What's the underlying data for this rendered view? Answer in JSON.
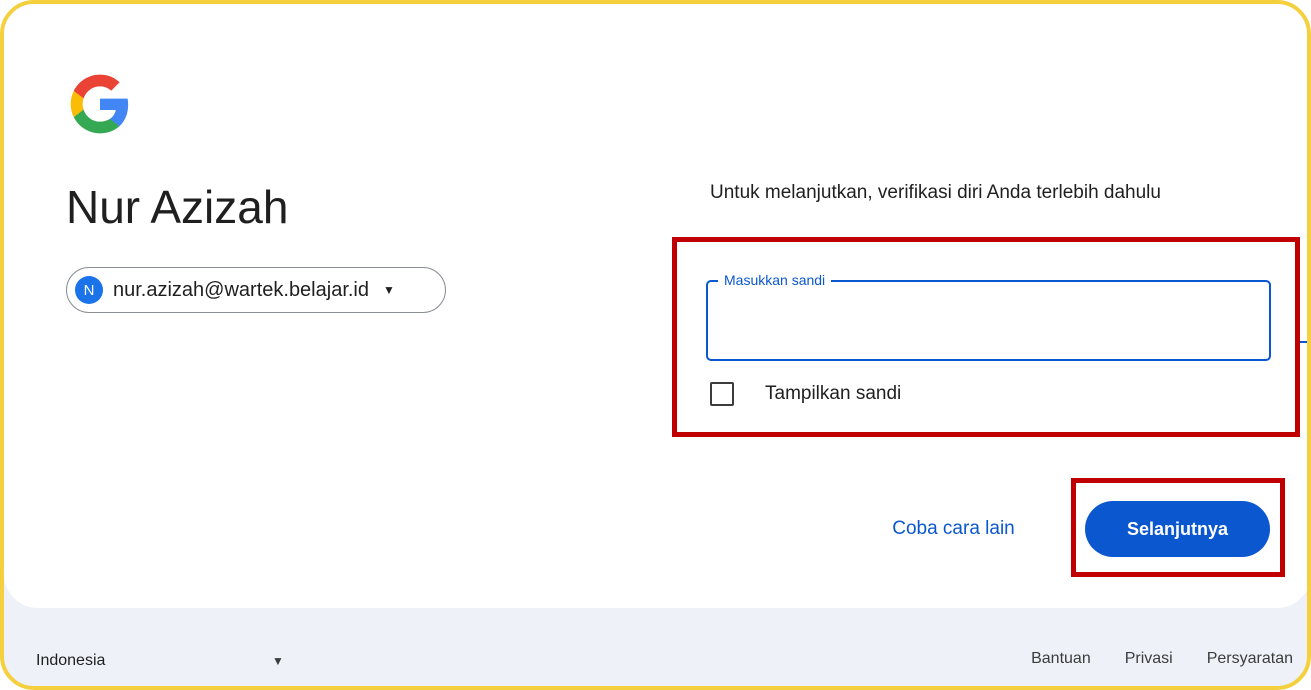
{
  "brand": {
    "logo_icon": "google-g-logo-icon"
  },
  "profile": {
    "name": "Nur Azizah",
    "email": "nur.azizah@wartek.belajar.id",
    "avatar_letter": "N",
    "chip_caret_icon": "caret-down-icon"
  },
  "verify": {
    "instruction": "Untuk melanjutkan, verifikasi diri Anda terlebih dahulu",
    "password_label": "Masukkan sandi",
    "password_value": "",
    "show_password_label": "Tampilkan sandi",
    "show_password_checked": false
  },
  "actions": {
    "try_other_label": "Coba cara lain",
    "next_label": "Selanjutnya"
  },
  "footer": {
    "language": "Indonesia",
    "links": [
      "Bantuan",
      "Privasi",
      "Persyaratan"
    ]
  },
  "colors": {
    "primary": "#0b57d0",
    "highlight": "#c00000",
    "frame": "#f4d03f"
  }
}
